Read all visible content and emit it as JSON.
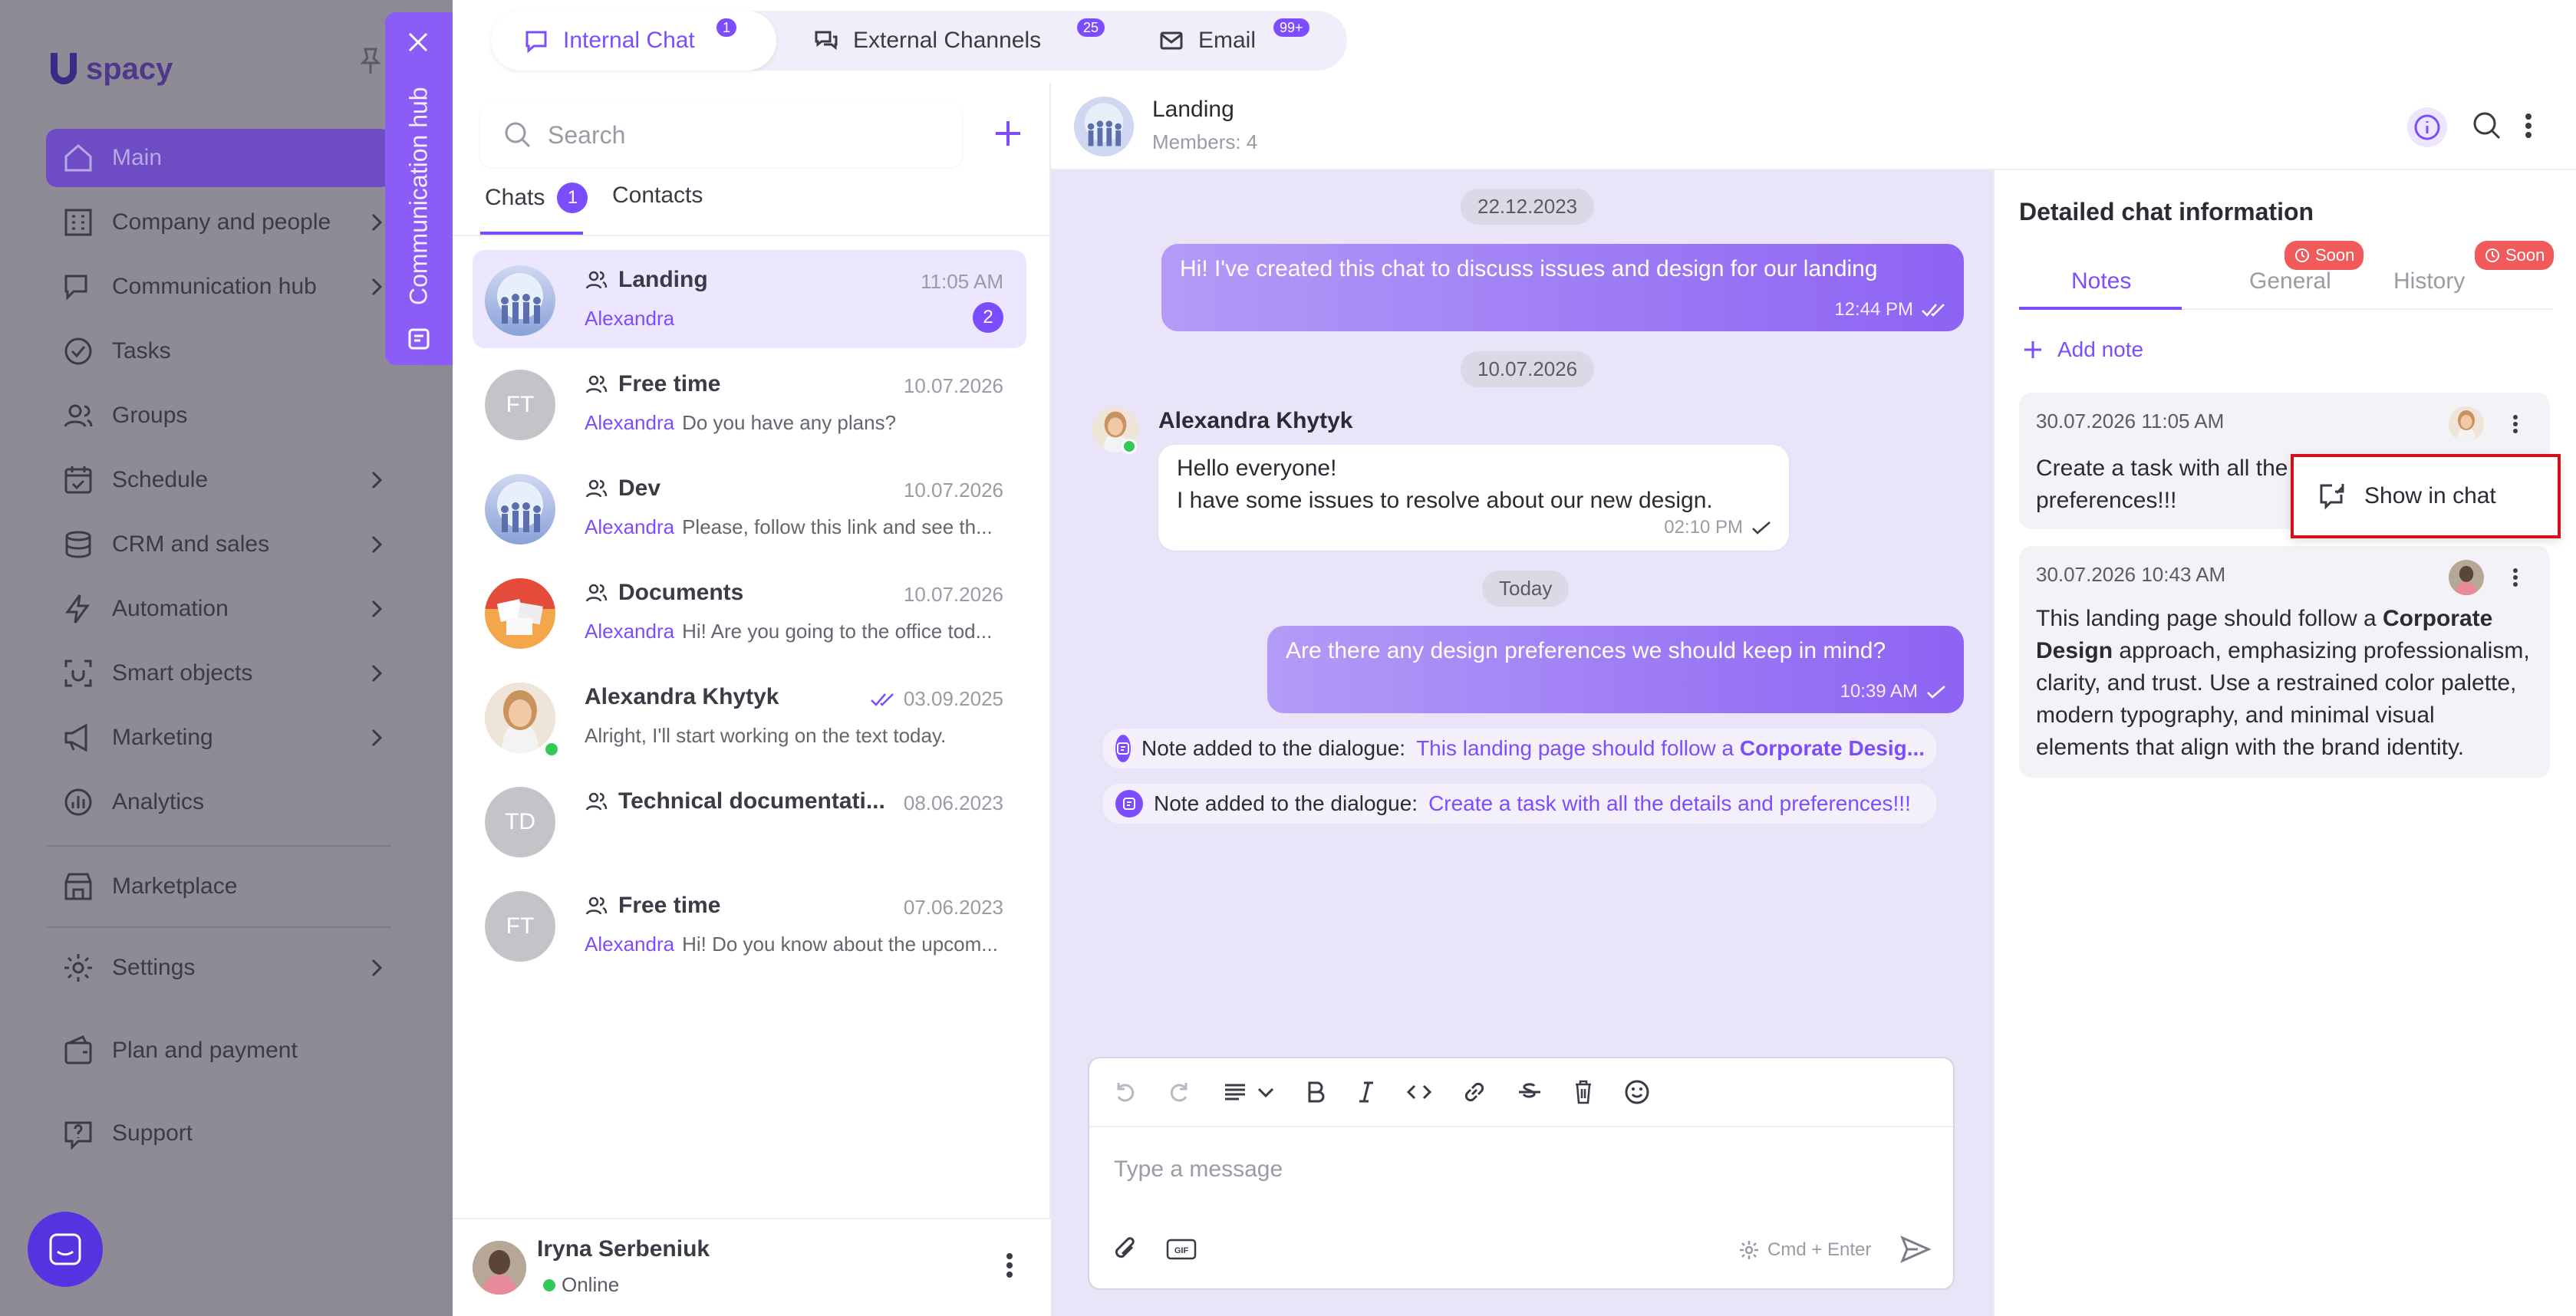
{
  "sidebar": {
    "logo_text": "spacy",
    "items": [
      {
        "label": "Main",
        "icon": "home-icon",
        "active": true
      },
      {
        "label": "Company and people",
        "icon": "building-icon"
      },
      {
        "label": "Communication hub",
        "icon": "chat-edit-icon"
      },
      {
        "label": "Tasks",
        "icon": "check-circle-icon"
      },
      {
        "label": "Groups",
        "icon": "users-icon"
      },
      {
        "label": "Schedule",
        "icon": "calendar-icon"
      },
      {
        "label": "CRM and sales",
        "icon": "coins-icon"
      },
      {
        "label": "Automation",
        "icon": "bolt-icon"
      },
      {
        "label": "Smart objects",
        "icon": "scan-icon"
      },
      {
        "label": "Marketing",
        "icon": "megaphone-icon"
      },
      {
        "label": "Analytics",
        "icon": "chart-icon"
      },
      {
        "label": "Marketplace",
        "icon": "store-icon"
      },
      {
        "label": "Settings",
        "icon": "gear-icon"
      },
      {
        "label": "Plan and payment",
        "icon": "wallet-icon"
      },
      {
        "label": "Support",
        "icon": "help-icon"
      }
    ]
  },
  "hub_tab": {
    "label": "Communication hub"
  },
  "top_tabs": [
    {
      "label": "Internal Chat",
      "badge": "1"
    },
    {
      "label": "External Channels",
      "badge": "25"
    },
    {
      "label": "Email",
      "badge": "99+"
    }
  ],
  "chat_list": {
    "search_placeholder": "Search",
    "tabs": [
      {
        "label": "Chats",
        "badge": "1"
      },
      {
        "label": "Contacts"
      }
    ],
    "chats": [
      {
        "name": "Landing",
        "time": "11:05 AM",
        "sender": "Alexandra",
        "preview": "",
        "unread": "2"
      },
      {
        "name": "Free time",
        "time": "10.07.2026",
        "sender": "Alexandra",
        "preview": "Do you have any plans?",
        "initials": "FT"
      },
      {
        "name": "Dev",
        "time": "10.07.2026",
        "sender": "Alexandra",
        "preview": "Please, follow this link and see th..."
      },
      {
        "name": "Documents",
        "time": "10.07.2026",
        "sender": "Alexandra",
        "preview": "Hi! Are you going to the office tod..."
      },
      {
        "name": "Alexandra Khytyk",
        "time": "03.09.2025",
        "sender": "",
        "preview": "Alright, I'll start working on the text today."
      },
      {
        "name": "Technical documentati...",
        "time": "08.06.2023",
        "sender": "",
        "preview": "",
        "initials": "TD"
      },
      {
        "name": "Free time",
        "time": "07.06.2023",
        "sender": "Alexandra",
        "preview": "Hi! Do you know about the upcom...",
        "initials": "FT"
      }
    ],
    "me": {
      "name": "Iryna Serbeniuk",
      "status": "Online"
    }
  },
  "chat": {
    "title": "Landing",
    "members": "Members: 4",
    "messages": {
      "date1": "22.12.2023",
      "m1_text": "Hi! I've created this chat to discuss issues and design for our landing",
      "m1_time": "12:44 PM",
      "date2": "10.07.2026",
      "m2_author": "Alexandra Khytyk",
      "m2_line1": "Hello everyone!",
      "m2_line2": "I have some issues to resolve about our new design.",
      "m2_time": "02:10 PM",
      "date3": "Today",
      "m3_text": "Are there any design preferences we should keep in mind?",
      "m3_time": "10:39 AM",
      "note1_prefix": "Note added to the dialogue:",
      "note1_link": "This landing page should follow a",
      "note1_bold": "Corporate Desig...",
      "note2_prefix": "Note added to the dialogue:",
      "note2_link": "Create a task with all the details and preferences!!!"
    },
    "composer_placeholder": "Type a message",
    "send_hint": "Cmd + Enter"
  },
  "details": {
    "title": "Detailed chat information",
    "tabs": [
      {
        "label": "Notes"
      },
      {
        "label": "General",
        "soon": "Soon"
      },
      {
        "label": "History",
        "soon": "Soon"
      }
    ],
    "add_note": "Add note",
    "note1_time": "30.07.2026 11:05 AM",
    "note1_line1": "Create a task with all the",
    "note1_line2": "preferences!!!",
    "note2_time": "30.07.2026 10:43 AM",
    "note2_l1a": "This landing page should follow a",
    "note2_l1b": "Corporate",
    "note2_l2a": "Design",
    "note2_l2b": "approach, emphasizing professionalism,",
    "note2_l3": "clarity, and trust. Use a restrained color palette,",
    "note2_l4": "modern typography, and minimal visual",
    "note2_l5": "elements that align with the brand identity.",
    "context_menu_item": "Show in chat"
  },
  "colors": {
    "accent": "#7c4dff",
    "highlight": "#d0101b",
    "soon": "#f05a5a"
  }
}
